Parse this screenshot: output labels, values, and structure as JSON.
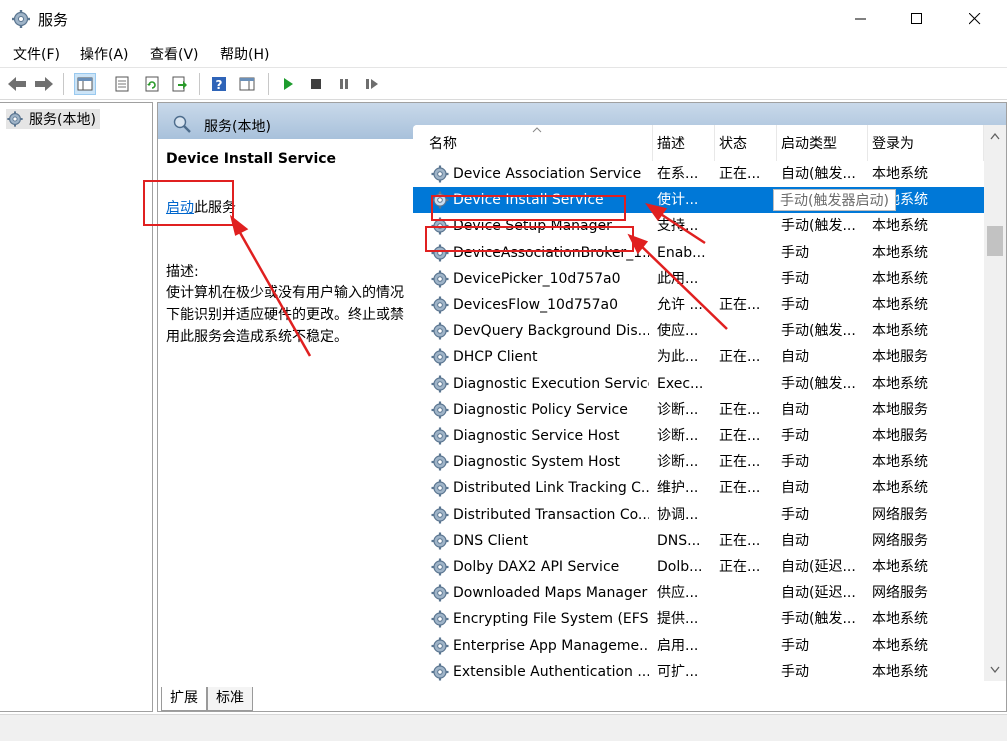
{
  "window": {
    "title": "服务"
  },
  "menu": [
    "文件(F)",
    "操作(A)",
    "查看(V)",
    "帮助(H)"
  ],
  "tree": {
    "root": "服务(本地)"
  },
  "pane": {
    "header": "服务(本地)",
    "selected_service": "Device Install Service",
    "start_link": "启动",
    "start_suffix": "此服务",
    "desc_label": "描述:",
    "desc_text": "使计算机在极少或没有用户输入的情况下能识别并适应硬件的更改。终止或禁用此服务会造成系统不稳定。"
  },
  "columns": [
    "名称",
    "描述",
    "状态",
    "启动类型",
    "登录为"
  ],
  "rows": [
    [
      "Device Association Service",
      "在系...",
      "正在...",
      "自动(触发...",
      "本地系统"
    ],
    [
      "Device Install Service",
      "使计...",
      "",
      "",
      "本地系统"
    ],
    [
      "Device Setup Manager",
      "支持...",
      "",
      "手动(触发...",
      "本地系统"
    ],
    [
      "DeviceAssociationBroker_1...",
      "Enab...",
      "",
      "手动",
      "本地系统"
    ],
    [
      "DevicePicker_10d757a0",
      "此用...",
      "",
      "手动",
      "本地系统"
    ],
    [
      "DevicesFlow_10d757a0",
      "允许 ...",
      "正在...",
      "手动",
      "本地系统"
    ],
    [
      "DevQuery Background Dis...",
      "使应...",
      "",
      "手动(触发...",
      "本地系统"
    ],
    [
      "DHCP Client",
      "为此...",
      "正在...",
      "自动",
      "本地服务"
    ],
    [
      "Diagnostic Execution Service",
      "Exec...",
      "",
      "手动(触发...",
      "本地系统"
    ],
    [
      "Diagnostic Policy Service",
      "诊断...",
      "正在...",
      "自动",
      "本地服务"
    ],
    [
      "Diagnostic Service Host",
      "诊断...",
      "正在...",
      "手动",
      "本地服务"
    ],
    [
      "Diagnostic System Host",
      "诊断...",
      "正在...",
      "手动",
      "本地系统"
    ],
    [
      "Distributed Link Tracking C...",
      "维护...",
      "正在...",
      "自动",
      "本地系统"
    ],
    [
      "Distributed Transaction Co...",
      "协调...",
      "",
      "手动",
      "网络服务"
    ],
    [
      "DNS Client",
      "DNS...",
      "正在...",
      "自动",
      "网络服务"
    ],
    [
      "Dolby DAX2 API Service",
      "Dolb...",
      "正在...",
      "自动(延迟...",
      "本地系统"
    ],
    [
      "Downloaded Maps Manager",
      "供应...",
      "",
      "自动(延迟...",
      "网络服务"
    ],
    [
      "Encrypting File System (EFS)",
      "提供...",
      "",
      "手动(触发...",
      "本地系统"
    ],
    [
      "Enterprise App Manageme...",
      "启用...",
      "",
      "手动",
      "本地系统"
    ],
    [
      "Extensible Authentication ...",
      "可扩...",
      "",
      "手动",
      "本地系统"
    ]
  ],
  "selected_index": 1,
  "tooltip": "手动(触发器启动)",
  "tabs": [
    "扩展",
    "标准"
  ]
}
